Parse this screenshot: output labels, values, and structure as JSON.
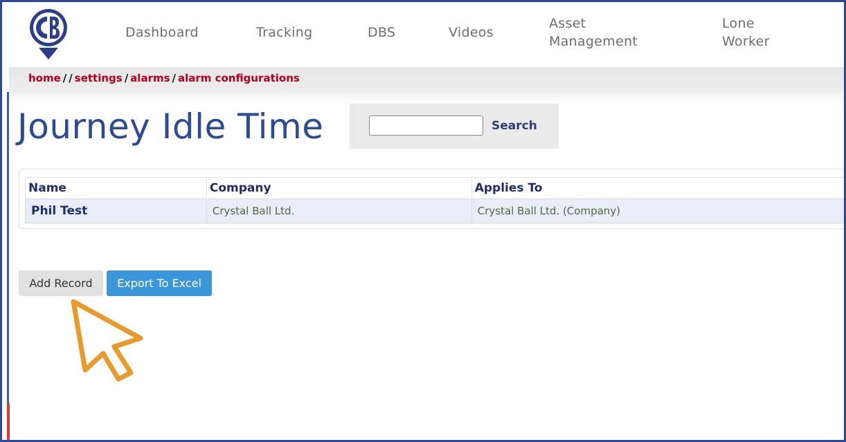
{
  "nav": {
    "items": [
      {
        "label": "Dashboard"
      },
      {
        "label": "Tracking"
      },
      {
        "label": "DBS"
      },
      {
        "label": "Videos"
      },
      {
        "label_line1": "Asset",
        "label_line2": "Management"
      },
      {
        "label_line1": "Lone",
        "label_line2": "Worker"
      }
    ]
  },
  "breadcrumb": {
    "items": [
      "home",
      "settings",
      "alarms",
      "alarm configurations"
    ],
    "separator": "/"
  },
  "page": {
    "title": "Journey Idle Time"
  },
  "search": {
    "value": "",
    "button_label": "Search"
  },
  "table": {
    "columns": [
      "Name",
      "Company",
      "Applies To"
    ],
    "rows": [
      {
        "name": "Phil Test",
        "company": "Crystal Ball Ltd.",
        "applies_to": "Crystal Ball Ltd. (Company)"
      }
    ]
  },
  "actions": {
    "add_label": "Add Record",
    "export_label": "Export To Excel"
  },
  "colors": {
    "brand_blue": "#2c4a96",
    "breadcrumb_red": "#b3001b",
    "export_button": "#3b96d9",
    "cursor_orange": "#e89a2c"
  },
  "icons": {
    "logo": "cb-logo-pin",
    "pointer": "arrow-cursor-icon"
  }
}
